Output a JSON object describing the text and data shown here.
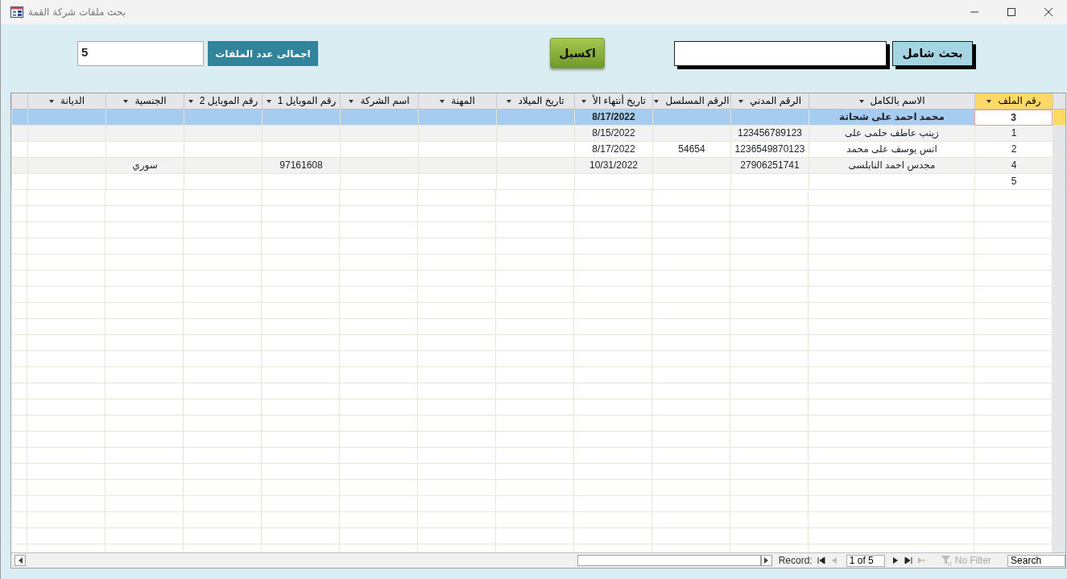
{
  "window": {
    "title": "بحث ملفات شركة القمة"
  },
  "form": {
    "search_button": "بحث شامل",
    "excel_button": "اكسيل",
    "total_label": "اجمالى عدد الملفات",
    "total_value": "5"
  },
  "columns": [
    {
      "label": "رقم الملف",
      "selected": true
    },
    {
      "label": "الاسم بالكامل",
      "selected": false
    },
    {
      "label": "الرقم المدني",
      "selected": false
    },
    {
      "label": "الرقم المسلسل",
      "selected": false
    },
    {
      "label": "تاريخ أنتهاء الأ",
      "selected": false
    },
    {
      "label": "تاريخ الميلاد",
      "selected": false
    },
    {
      "label": "المهنة",
      "selected": false
    },
    {
      "label": "اسم الشركة",
      "selected": false
    },
    {
      "label": "رقم الموبايل 1",
      "selected": false
    },
    {
      "label": "رقم الموبايل 2",
      "selected": false
    },
    {
      "label": "الجنسية",
      "selected": false
    },
    {
      "label": "الديانة",
      "selected": false
    }
  ],
  "rows": [
    {
      "selected": true,
      "cells": [
        "3",
        "محمد احمد على شحاتة",
        null,
        null,
        "8/17/2022",
        null,
        null,
        null,
        null,
        null,
        null,
        null
      ]
    },
    {
      "selected": false,
      "cells": [
        "1",
        "زينب عاطف حلمى على",
        "123456789123",
        null,
        "8/15/2022",
        null,
        null,
        null,
        null,
        null,
        null,
        null
      ]
    },
    {
      "selected": false,
      "cells": [
        "2",
        "انس يوسف على محمد",
        "1236549870123",
        "54654",
        "8/17/2022",
        null,
        null,
        null,
        null,
        null,
        null,
        null
      ]
    },
    {
      "selected": false,
      "cells": [
        "4",
        "مجدس احمد النابلسى",
        "27906251741",
        null,
        "10/31/2022",
        null,
        null,
        null,
        "97161608",
        null,
        "سوري",
        null
      ]
    },
    {
      "selected": false,
      "cells": [
        "5",
        null,
        null,
        null,
        null,
        null,
        null,
        null,
        null,
        null,
        null,
        null
      ]
    }
  ],
  "record_nav": {
    "label": "Record:",
    "position": "1 of 5",
    "buttons": [
      {
        "kind": "first",
        "disabled": false
      },
      {
        "kind": "previous",
        "disabled": true
      },
      {
        "kind": "next",
        "disabled": false
      },
      {
        "kind": "last",
        "disabled": false
      },
      {
        "kind": "new",
        "disabled": true
      }
    ],
    "filter": {
      "label": "No Filter",
      "disabled": true
    },
    "search": {
      "placeholder": "Search"
    }
  }
}
